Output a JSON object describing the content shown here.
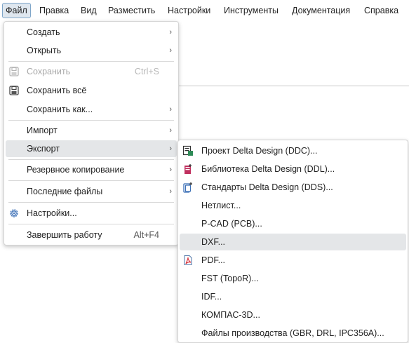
{
  "menubar": [
    "Файл",
    "Правка",
    "Вид",
    "Разместить",
    "Настройки",
    "Инструменты",
    "Документация",
    "Справка"
  ],
  "file_menu": {
    "create": "Создать",
    "open": "Открыть",
    "save": "Сохранить",
    "save_shortcut": "Ctrl+S",
    "save_all": "Сохранить всё",
    "save_as": "Сохранить как...",
    "import": "Импорт",
    "export": "Экспорт",
    "backup": "Резервное копирование",
    "recent": "Последние файлы",
    "settings": "Настройки...",
    "exit": "Завершить работу",
    "exit_shortcut": "Alt+F4",
    "submenu_arrow": "›"
  },
  "export_menu": {
    "ddc": "Проект Delta Design (DDC)...",
    "ddl": "Библиотека Delta Design (DDL)...",
    "dds": "Стандарты Delta Design (DDS)...",
    "netlist": "Нетлист...",
    "pcad": "P-CAD (PCB)...",
    "dxf": "DXF...",
    "pdf": "PDF...",
    "fst": "FST (TopoR)...",
    "idf": "IDF...",
    "kompas": "КОМПАС-3D...",
    "production": "Файлы производства (GBR, DRL, IPC356A)..."
  },
  "colors": {
    "accent_border": "#7fa6c9",
    "hover": "#e4e6e8",
    "disabled_text": "#a8a8a8",
    "pdf_red": "#d9363e"
  }
}
